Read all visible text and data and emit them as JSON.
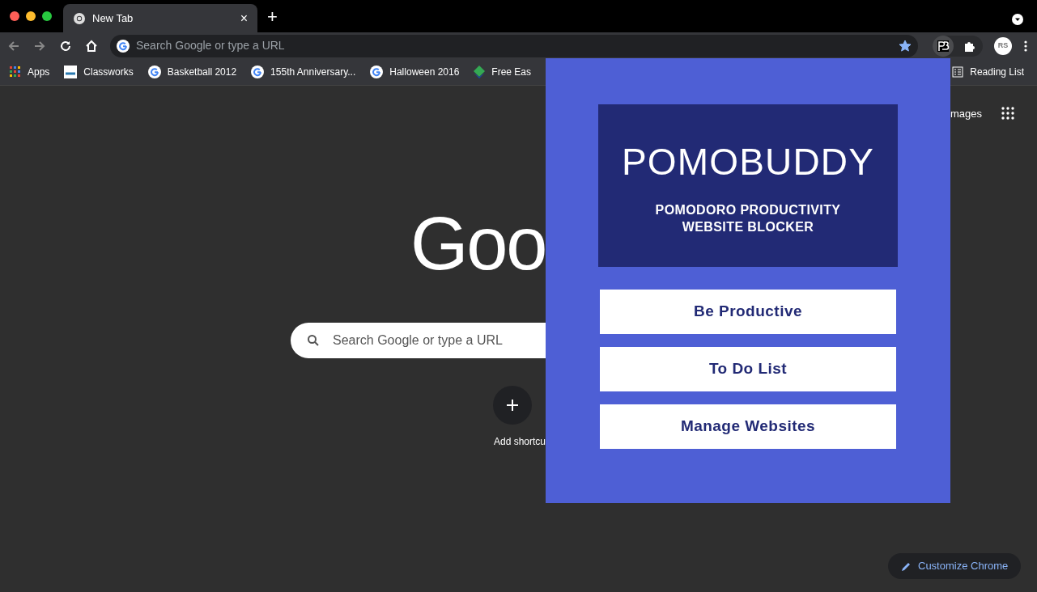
{
  "tab": {
    "title": "New Tab",
    "close": "×",
    "new_tab": "+"
  },
  "toolbar": {
    "omnibox_placeholder": "Search Google or type a URL",
    "star_on": true
  },
  "bookmarks": [
    {
      "kind": "apps",
      "label": "Apps"
    },
    {
      "kind": "rsm",
      "label": "Classworks"
    },
    {
      "kind": "google",
      "label": "Basketball 2012"
    },
    {
      "kind": "google",
      "label": "155th Anniversary..."
    },
    {
      "kind": "google",
      "label": "Halloween 2016"
    },
    {
      "kind": "diamond",
      "label": "Free Eas"
    }
  ],
  "reading_list": "Reading List",
  "profile_initials": "RS",
  "new_tab_page": {
    "images_link": "mages",
    "logo": "Goo",
    "search_placeholder": "Search Google or type a URL",
    "add_shortcut": "Add shortcu",
    "customize": "Customize Chrome"
  },
  "popup": {
    "title": "POMOBUDDY",
    "subtitle": "POMODORO PRODUCTIVITY WEBSITE BLOCKER",
    "buttons": [
      "Be Productive",
      "To Do List",
      "Manage Websites"
    ]
  }
}
